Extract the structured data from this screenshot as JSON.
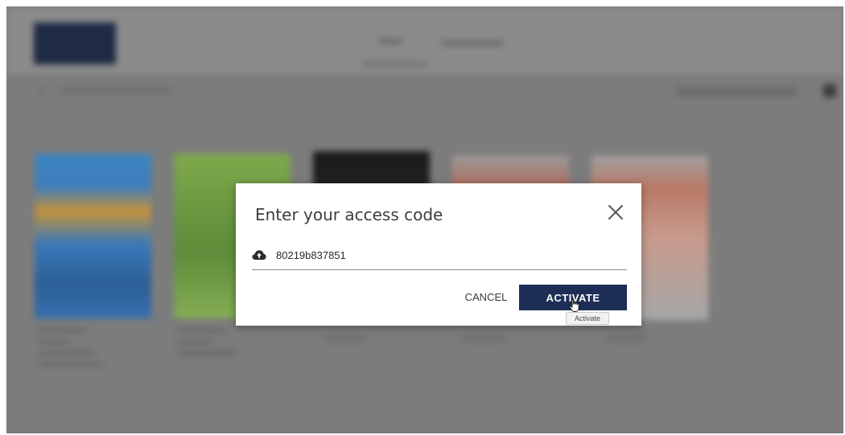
{
  "dialog": {
    "title": "Enter your access code",
    "code_value": "80219b837851",
    "cancel_label": "CANCEL",
    "activate_label": "ACTIVATE",
    "activate_tooltip": "Activate"
  },
  "icons": {
    "close": "close-icon",
    "cloud": "cloud-upload-icon"
  },
  "colors": {
    "primary_button": "#1d2e56",
    "overlay": "#7c7c7c"
  }
}
